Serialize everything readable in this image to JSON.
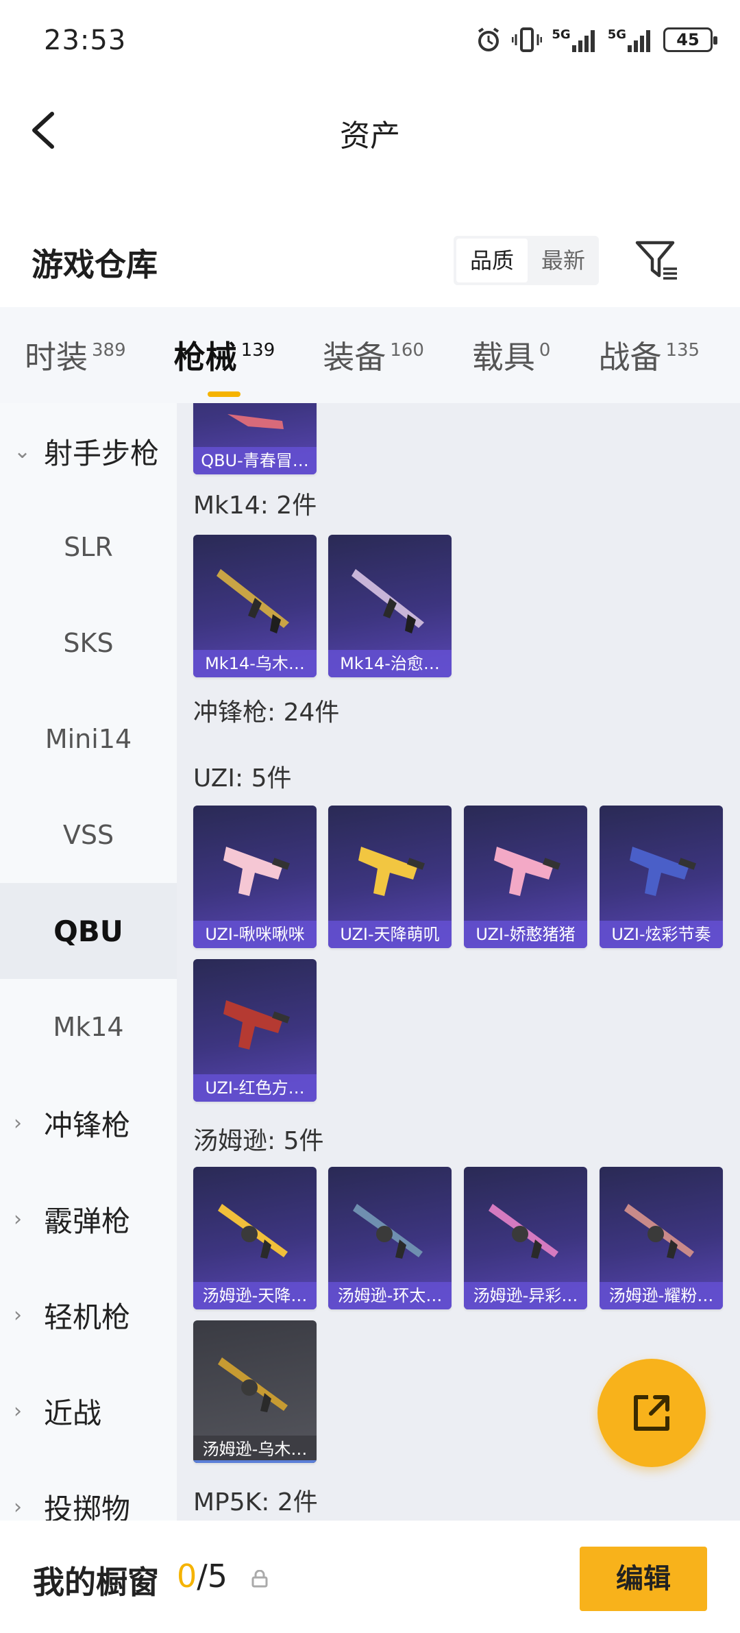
{
  "status_bar": {
    "time": "23:53",
    "battery": "45",
    "signal_1": "5G",
    "signal_2": "5G"
  },
  "header": {
    "title": "资产"
  },
  "warehouse": {
    "title": "游戏仓库",
    "sort_options": [
      "品质",
      "最新"
    ],
    "active_sort": "品质"
  },
  "tabs": [
    {
      "label": "时装",
      "count": "389",
      "active": false
    },
    {
      "label": "枪械",
      "count": "139",
      "active": true
    },
    {
      "label": "装备",
      "count": "160",
      "active": false
    },
    {
      "label": "载具",
      "count": "0",
      "active": false
    },
    {
      "label": "战备",
      "count": "135",
      "active": false
    }
  ],
  "sidebar": {
    "items": [
      {
        "label": "射手步枪",
        "type": "group",
        "expanded": true
      },
      {
        "label": "SLR",
        "type": "sub"
      },
      {
        "label": "SKS",
        "type": "sub"
      },
      {
        "label": "Mini14",
        "type": "sub"
      },
      {
        "label": "VSS",
        "type": "sub"
      },
      {
        "label": "QBU",
        "type": "sub",
        "active": true
      },
      {
        "label": "Mk14",
        "type": "sub"
      },
      {
        "label": "冲锋枪",
        "type": "group",
        "expanded": false
      },
      {
        "label": "霰弹枪",
        "type": "group",
        "expanded": false
      },
      {
        "label": "轻机枪",
        "type": "group",
        "expanded": false
      },
      {
        "label": "近战",
        "type": "group",
        "expanded": false
      },
      {
        "label": "投掷物",
        "type": "group",
        "expanded": false
      }
    ]
  },
  "content": {
    "top_card": {
      "name": "QBU-青春冒…"
    },
    "mk14_section": "Mk14: 2件",
    "mk14_cards": [
      {
        "name": "Mk14-乌木…",
        "art_color": "#c9a445"
      },
      {
        "name": "Mk14-治愈…",
        "art_color": "#c8b5d8"
      }
    ],
    "smg_section": "冲锋枪: 24件",
    "uzi_section": "UZI: 5件",
    "uzi_cards": [
      {
        "name": "UZI-啾咪啾咪",
        "art_color": "#f5c7d4"
      },
      {
        "name": "UZI-天降萌叽",
        "art_color": "#f2c641"
      },
      {
        "name": "UZI-娇憨猪猪",
        "art_color": "#f3a9c6"
      },
      {
        "name": "UZI-炫彩节奏",
        "art_color": "#4a5fc8"
      },
      {
        "name": "UZI-红色方…",
        "art_color": "#b53a32"
      }
    ],
    "tommy_section": "汤姆逊: 5件",
    "tommy_cards": [
      {
        "name": "汤姆逊-天降…",
        "art_color": "#f1bf3b"
      },
      {
        "name": "汤姆逊-环太…",
        "art_color": "#6f8fb0"
      },
      {
        "name": "汤姆逊-异彩…",
        "art_color": "#d57ac0"
      },
      {
        "name": "汤姆逊-耀粉…",
        "art_color": "#c98a8a"
      },
      {
        "name": "汤姆逊-乌木…",
        "art_color": "#c79b32"
      }
    ],
    "mp5k_section": "MP5K: 2件"
  },
  "bottom": {
    "title": "我的橱窗",
    "current": "0",
    "total": "/5",
    "edit_label": "编辑"
  },
  "colors": {
    "accent": "#f8b21b",
    "card_purple": "#5a47b6"
  }
}
